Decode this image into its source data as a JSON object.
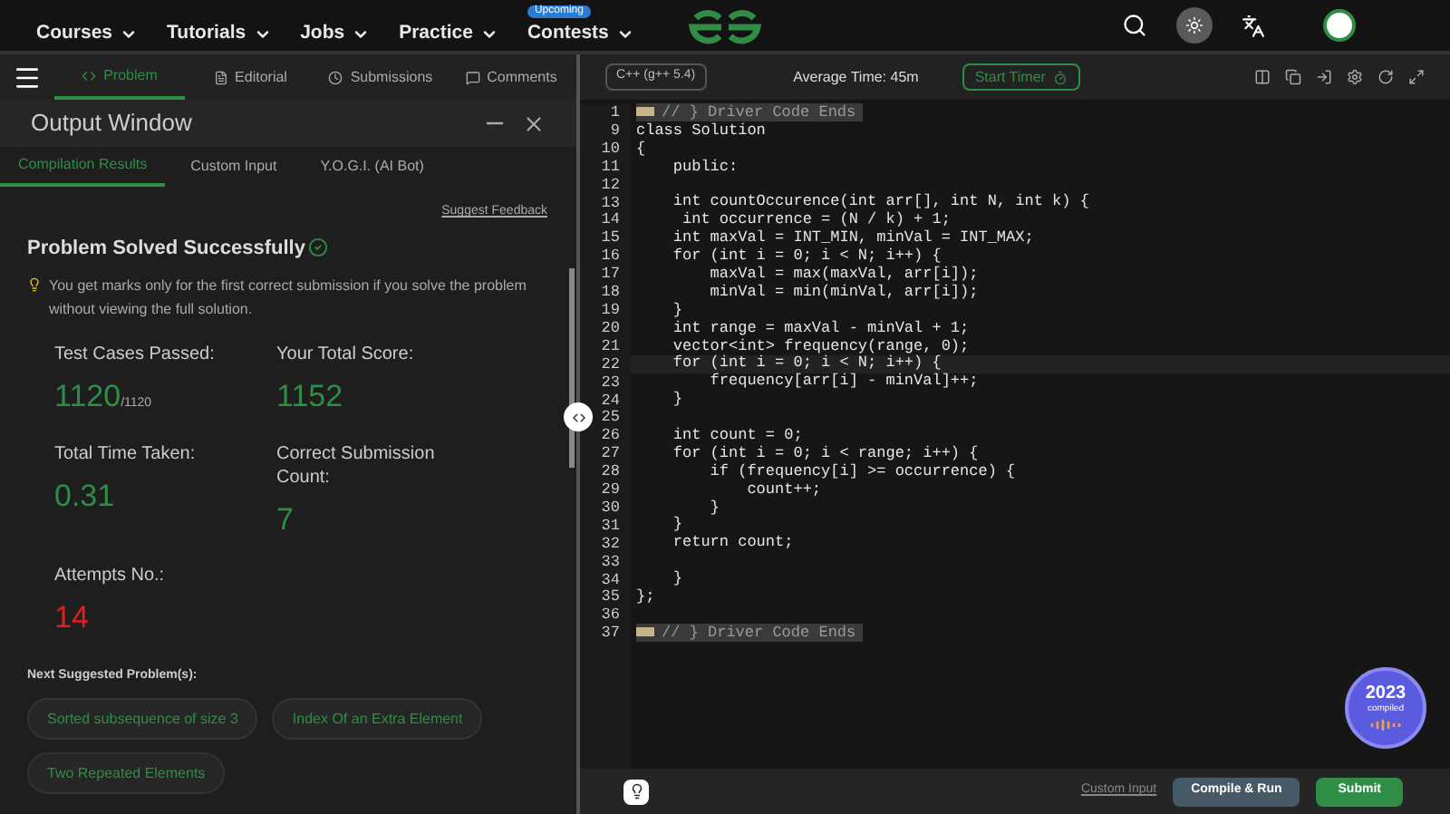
{
  "nav": {
    "items": [
      {
        "label": "Courses"
      },
      {
        "label": "Tutorials"
      },
      {
        "label": "Jobs"
      },
      {
        "label": "Practice"
      },
      {
        "label": "Contests",
        "badge": "Upcoming"
      }
    ]
  },
  "problem_tabs": [
    {
      "label": "Problem",
      "selected": true
    },
    {
      "label": "Editorial",
      "selected": false
    },
    {
      "label": "Submissions",
      "selected": false
    },
    {
      "label": "Comments",
      "selected": false
    }
  ],
  "output_window": {
    "title": "Output Window",
    "tabs": [
      {
        "label": "Compilation Results",
        "selected": true
      },
      {
        "label": "Custom Input",
        "selected": false
      },
      {
        "label": "Y.O.G.I. (AI Bot)",
        "selected": false
      }
    ],
    "feedback_link": "Suggest Feedback",
    "status": "Problem Solved Successfully",
    "note": "You get marks only for the first correct submission if you solve the problem without viewing the full solution.",
    "stats": [
      {
        "label": "Test Cases Passed:",
        "value": "1120",
        "suffix": "/1120",
        "color": "#2f8d46"
      },
      {
        "label": "Your Total Score:",
        "value": "1152",
        "color": "#2f8d46"
      },
      {
        "label": "Total Time Taken:",
        "value": "0.31",
        "color": "#2f8d46"
      },
      {
        "label": "Correct Submission Count:",
        "value": "7",
        "color": "#2f8d46"
      },
      {
        "label": "Attempts No.:",
        "value": "14",
        "color": "#e02020"
      }
    ],
    "suggested_heading": "Next Suggested Problem(s):",
    "suggested": [
      "Sorted subsequence of size 3",
      "Index Of an Extra Element",
      "Two Repeated Elements"
    ]
  },
  "editor": {
    "language": "C++ (g++ 5.4)",
    "average_time": "Average Time: 45m",
    "timer_button": "Start Timer",
    "lines": [
      {
        "n": "1",
        "code": "// } Driver Code Ends",
        "folded": true,
        "selected": false
      },
      {
        "n": "9",
        "code": "class Solution",
        "folded": false,
        "selected": false
      },
      {
        "n": "10",
        "code": "{",
        "folded": false,
        "selected": false
      },
      {
        "n": "11",
        "code": "    public:",
        "folded": false,
        "selected": false
      },
      {
        "n": "12",
        "folded": false,
        "selected": false
      },
      {
        "n": "13",
        "code": "    int countOccurence(int arr[], int N, int k) {",
        "folded": false,
        "selected": false
      },
      {
        "n": "14",
        "code": "     int occurrence = (N / k) + 1;",
        "folded": false,
        "selected": false
      },
      {
        "n": "15",
        "code": "    int maxVal = INT_MIN, minVal = INT_MAX;",
        "folded": false,
        "selected": false
      },
      {
        "n": "16",
        "code": "    for (int i = 0; i < N; i++) {",
        "folded": false,
        "selected": false
      },
      {
        "n": "17",
        "code": "        maxVal = max(maxVal, arr[i]);",
        "folded": false,
        "selected": false
      },
      {
        "n": "18",
        "code": "        minVal = min(minVal, arr[i]);",
        "folded": false,
        "selected": false
      },
      {
        "n": "19",
        "code": "    }",
        "folded": false,
        "selected": false
      },
      {
        "n": "20",
        "code": "    int range = maxVal - minVal + 1;",
        "folded": false,
        "selected": false
      },
      {
        "n": "21",
        "code": "    vector<int> frequency(range, 0);",
        "folded": false,
        "selected": false
      },
      {
        "n": "22",
        "code": "    for (int i = 0; i < N; i++) {",
        "folded": false,
        "selected": true
      },
      {
        "n": "23",
        "code": "        frequency[arr[i] - minVal]++;",
        "folded": false,
        "selected": false
      },
      {
        "n": "24",
        "code": "    }",
        "folded": false,
        "selected": false
      },
      {
        "n": "25",
        "folded": false,
        "selected": false
      },
      {
        "n": "26",
        "code": "    int count = 0;",
        "folded": false,
        "selected": false
      },
      {
        "n": "27",
        "code": "    for (int i = 0; i < range; i++) {",
        "folded": false,
        "selected": false
      },
      {
        "n": "28",
        "code": "        if (frequency[i] >= occurrence) {",
        "folded": false,
        "selected": false
      },
      {
        "n": "29",
        "code": "            count++;",
        "folded": false,
        "selected": false
      },
      {
        "n": "30",
        "code": "        }",
        "folded": false,
        "selected": false
      },
      {
        "n": "31",
        "code": "    }",
        "folded": false,
        "selected": false
      },
      {
        "n": "32",
        "code": "    return count;",
        "folded": false,
        "selected": false
      },
      {
        "n": "33",
        "folded": false,
        "selected": false
      },
      {
        "n": "34",
        "code": "    }",
        "folded": false,
        "selected": false
      },
      {
        "n": "35",
        "code": "};",
        "folded": false,
        "selected": false
      },
      {
        "n": "36",
        "folded": false,
        "selected": false
      },
      {
        "n": "37",
        "code": "// } Driver Code Ends",
        "folded": true,
        "selected": false
      }
    ],
    "badge": {
      "year": "2023",
      "caption": "compiled"
    },
    "custom_input_link": "Custom Input",
    "compile_button": "Compile & Run",
    "submit_button": "Submit"
  }
}
